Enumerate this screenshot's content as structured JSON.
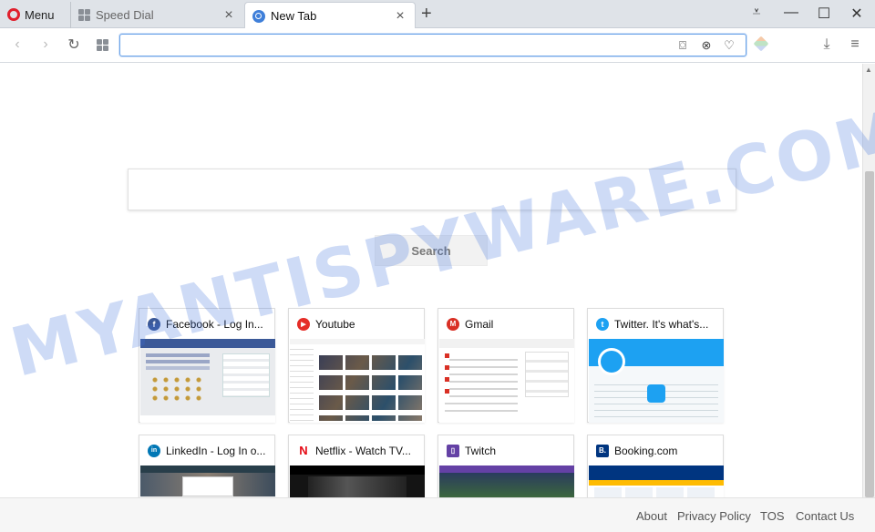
{
  "browser": {
    "menu_label": "Menu",
    "tabs": [
      {
        "label": "Speed Dial",
        "icon": "speed-dial-icon",
        "active": false
      },
      {
        "label": "New Tab",
        "icon": "search-icon",
        "active": true
      }
    ],
    "address_bar": {
      "value": "",
      "placeholder": ""
    }
  },
  "page": {
    "search": {
      "value": "",
      "placeholder": "",
      "button_label": "Search"
    },
    "tiles": [
      {
        "title": "Facebook - Log In...",
        "icon": "facebook-icon",
        "color": "#3b5998",
        "glyph": "f"
      },
      {
        "title": "Youtube",
        "icon": "youtube-icon",
        "color": "#e52d27",
        "glyph": "▶"
      },
      {
        "title": "Gmail",
        "icon": "gmail-icon",
        "color": "#d93025",
        "glyph": "M"
      },
      {
        "title": "Twitter. It's what's...",
        "icon": "twitter-icon",
        "color": "#1da1f2",
        "glyph": "t"
      },
      {
        "title": "LinkedIn - Log In o...",
        "icon": "linkedin-icon",
        "color": "#0077b5",
        "glyph": "in"
      },
      {
        "title": "Netflix - Watch TV...",
        "icon": "netflix-icon",
        "color": "#e50914",
        "glyph": "N"
      },
      {
        "title": "Twitch",
        "icon": "twitch-icon",
        "color": "#6441a5",
        "glyph": "▯"
      },
      {
        "title": "Booking.com",
        "icon": "booking-icon",
        "color": "#003580",
        "glyph": "B."
      }
    ],
    "watermark": "MYANTISPYWARE.COM"
  },
  "footer": {
    "links": [
      "About",
      "Privacy Policy",
      "TOS",
      "Contact Us"
    ]
  }
}
